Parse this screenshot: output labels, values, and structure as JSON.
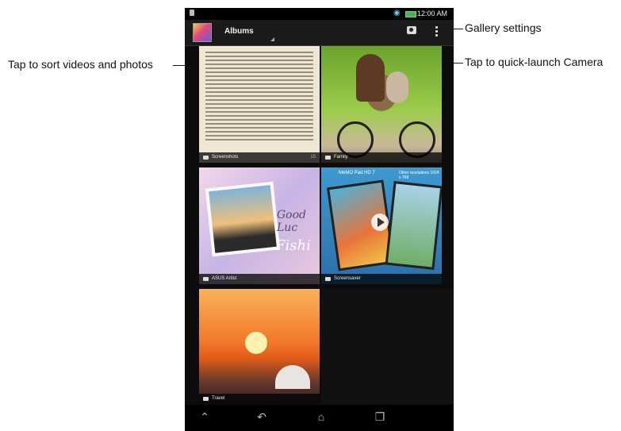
{
  "status_bar": {
    "time": "12:00 AM"
  },
  "action_bar": {
    "title": "Albums"
  },
  "albums": [
    {
      "name": "Screenshots",
      "count": "15"
    },
    {
      "name": "Family",
      "count": ""
    },
    {
      "name": "ASUS Artist",
      "count": ""
    },
    {
      "name": "Screensaver",
      "count": ""
    },
    {
      "name": "Travel",
      "count": ""
    }
  ],
  "screensaver_art": {
    "caption_left": "MeMO Pad HD 7",
    "caption_right": "Other resolutions 1024 x 768"
  },
  "artist_art": {
    "script1": "Good Luc",
    "script2": "Fishi"
  },
  "callouts": {
    "sort": "Tap to sort videos and photos",
    "settings": "Gallery settings",
    "camera": "Tap to quick-launch Camera"
  },
  "nav_icons": [
    "back-icon",
    "home-icon",
    "recent-apps-icon",
    "asus-menu-icon"
  ]
}
